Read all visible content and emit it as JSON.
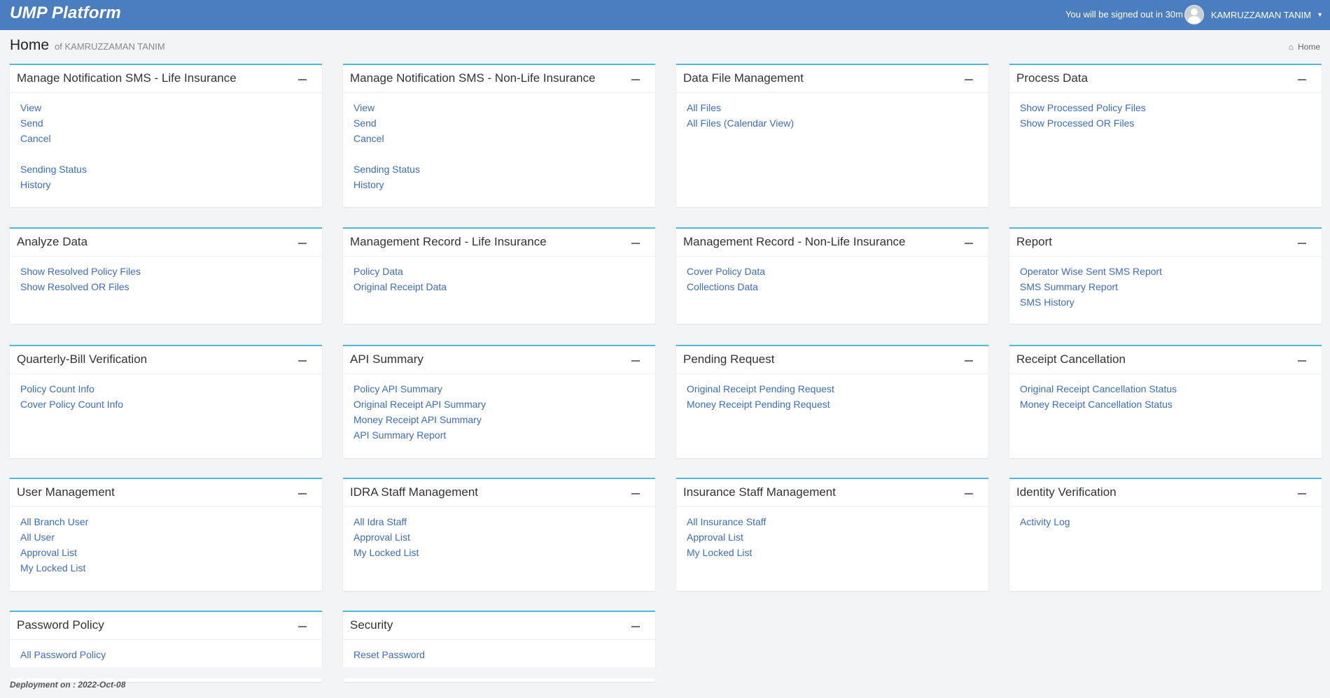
{
  "header": {
    "brand": "UMP Platform",
    "signout_notice": "You will be signed out in 30m",
    "user_name": "KAMRUZZAMAN TANIM",
    "bar_color": "#4a7ec0"
  },
  "page": {
    "title": "Home",
    "subtitle": "of KAMRUZZAMAN TANIM",
    "breadcrumb": "Home"
  },
  "panels": [
    {
      "title": "Manage Notification SMS - Life Insurance",
      "links": [
        "View",
        "Send",
        "Cancel",
        "",
        "Sending Status",
        "History"
      ]
    },
    {
      "title": "Manage Notification SMS - Non-Life Insurance",
      "links": [
        "View",
        "Send",
        "Cancel",
        "",
        "Sending Status",
        "History"
      ]
    },
    {
      "title": "Data File Management",
      "links": [
        "All Files",
        "All Files (Calendar View)"
      ]
    },
    {
      "title": "Process Data",
      "links": [
        "Show Processed Policy Files",
        "Show Processed OR Files"
      ]
    },
    {
      "title": "Analyze Data",
      "links": [
        "Show Resolved Policy Files",
        "Show Resolved OR Files"
      ]
    },
    {
      "title": "Management Record - Life Insurance",
      "links": [
        "Policy Data",
        "Original Receipt Data"
      ]
    },
    {
      "title": "Management Record - Non-Life Insurance",
      "links": [
        "Cover Policy Data",
        "Collections Data"
      ]
    },
    {
      "title": "Report",
      "links": [
        "Operator Wise Sent SMS Report",
        "SMS Summary Report",
        "SMS History"
      ]
    },
    {
      "title": "Quarterly-Bill Verification",
      "links": [
        "Policy Count Info",
        "Cover Policy Count Info"
      ]
    },
    {
      "title": "API Summary",
      "links": [
        "Policy API Summary",
        "Original Receipt API Summary",
        "Money Receipt API Summary",
        "API Summary Report"
      ]
    },
    {
      "title": "Pending Request",
      "links": [
        "Original Receipt Pending Request",
        "Money Receipt Pending Request"
      ]
    },
    {
      "title": "Receipt Cancellation",
      "links": [
        "Original Receipt Cancellation Status",
        "Money Receipt Cancellation Status"
      ]
    },
    {
      "title": "User Management",
      "links": [
        "All Branch User",
        "All User",
        "Approval List",
        "My Locked List"
      ]
    },
    {
      "title": "IDRA Staff Management",
      "links": [
        "All Idra Staff",
        "Approval List",
        "My Locked List"
      ]
    },
    {
      "title": "Insurance Staff Management",
      "links": [
        "All Insurance Staff",
        "Approval List",
        "My Locked List"
      ]
    },
    {
      "title": "Identity Verification",
      "links": [
        "Activity Log"
      ]
    },
    {
      "title": "Password Policy",
      "links": [
        "All Password Policy"
      ]
    },
    {
      "title": "Security",
      "links": [
        "Reset Password"
      ]
    }
  ],
  "footer": {
    "deployment": "Deployment on : 2022-Oct-08"
  },
  "colors": {
    "panel_accent": "#4fb6dd",
    "link": "#3a6cc0",
    "background": "#f3f4f6"
  }
}
